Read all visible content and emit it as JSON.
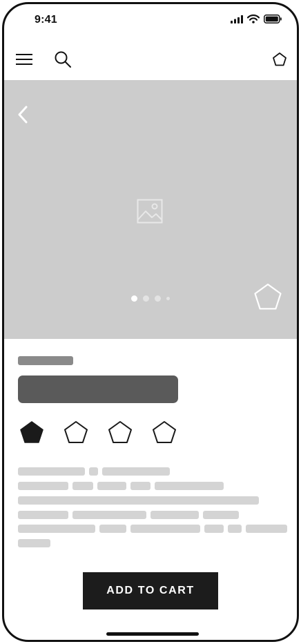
{
  "status_bar": {
    "time": "9:41",
    "icons": [
      "signal-icon",
      "wifi-icon",
      "battery-icon"
    ]
  },
  "nav": {
    "left_icons": [
      "menu-icon",
      "search-icon"
    ],
    "right_icon": "pentagon-icon"
  },
  "hero": {
    "background": "#cccccc",
    "back_icon": "chevron-left-icon",
    "placeholder_icon": "image-icon",
    "carousel": {
      "total": 4,
      "active": 1
    },
    "favorite_icon": "pentagon-outline-icon"
  },
  "product": {
    "label_color": "#8a8a8a",
    "title_color": "#5a5a5a",
    "swatches": [
      {
        "icon": "pentagon-filled-icon",
        "selected": true
      },
      {
        "icon": "pentagon-outline-icon",
        "selected": false
      },
      {
        "icon": "pentagon-outline-icon",
        "selected": false
      },
      {
        "icon": "pentagon-outline-icon",
        "selected": false
      }
    ]
  },
  "cta": {
    "label": "ADD TO CART",
    "color": "#1c1c1c"
  }
}
